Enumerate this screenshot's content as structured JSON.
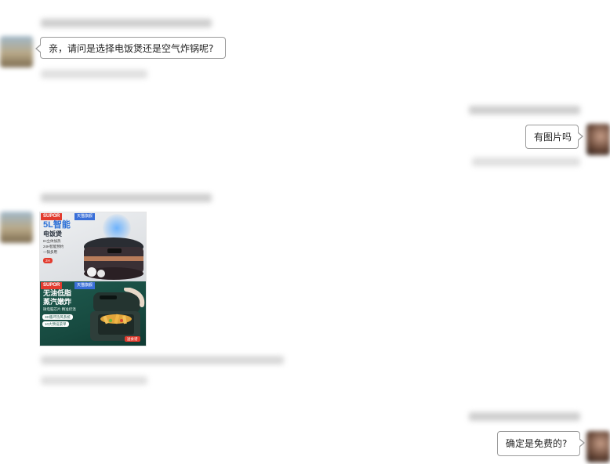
{
  "messages": [
    {
      "side": "left",
      "text": "亲，请问是选择电饭煲还是空气炸锅呢?"
    },
    {
      "side": "right",
      "text": "有图片吗"
    },
    {
      "side": "left",
      "type": "image",
      "image": {
        "top": {
          "brand": "SUPOR",
          "store_tag": "天猫旗舰",
          "headline": "5L智能",
          "subheadline": "电饭煲",
          "features": [
            "IH立体加热",
            "24H智能预约",
            "一锅多用"
          ],
          "badge": "2H"
        },
        "bottom": {
          "brand": "SUPOR",
          "store_tag": "天猫旗舰",
          "headline_line1": "无油低脂",
          "headline_line2": "蒸汽嫩炸",
          "features_line": "微电脑芯片 精准控温",
          "pill1": "3D循环热风系统",
          "pill2": "10大预设菜单",
          "corner_badge": "送食谱"
        }
      }
    },
    {
      "side": "right",
      "text": "确定是免费的?"
    }
  ]
}
